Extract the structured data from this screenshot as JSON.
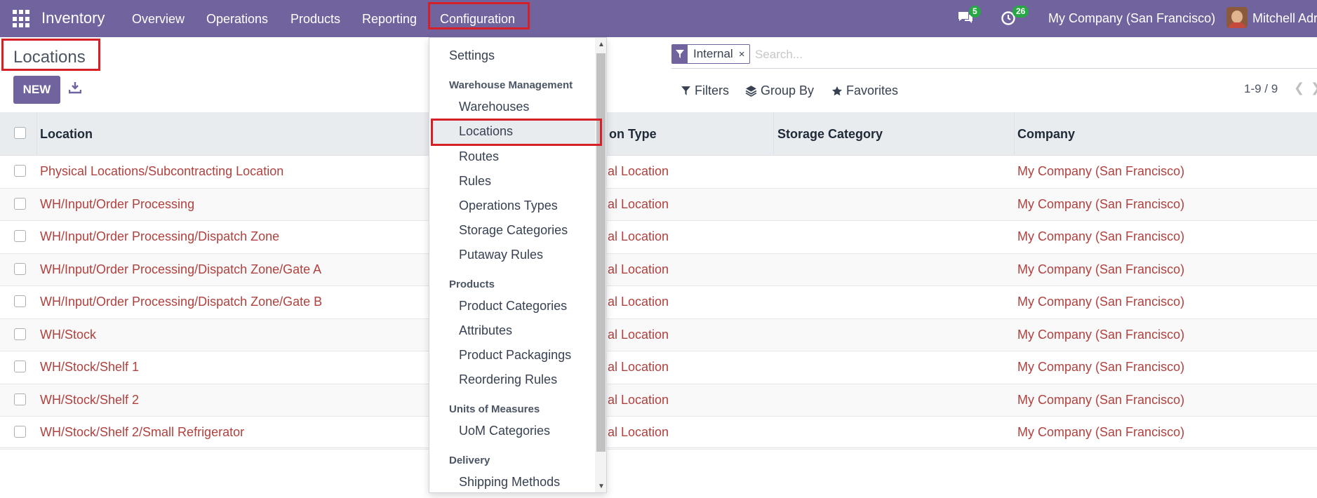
{
  "navbar": {
    "app_name": "Inventory",
    "menu": [
      "Overview",
      "Operations",
      "Products",
      "Reporting",
      "Configuration"
    ],
    "messages_count": "5",
    "activities_count": "26",
    "company": "My Company (San Francisco)",
    "user": "Mitchell Adr"
  },
  "control": {
    "title": "Locations",
    "new_label": "NEW",
    "facet_value": "Internal",
    "facet_remove": "×",
    "search_placeholder": "Search...",
    "filters_label": "Filters",
    "group_by_label": "Group By",
    "favorites_label": "Favorites",
    "pager": "1-9 / 9"
  },
  "table": {
    "headers": [
      "Location",
      "Location Type",
      "Storage Category",
      "Company"
    ],
    "header_type_visible": "on Type",
    "rows": [
      {
        "location": "Physical Locations/Subcontracting Location",
        "type": "al Location",
        "company": "My Company (San Francisco)"
      },
      {
        "location": "WH/Input/Order Processing",
        "type": "al Location",
        "company": "My Company (San Francisco)"
      },
      {
        "location": "WH/Input/Order Processing/Dispatch Zone",
        "type": "al Location",
        "company": "My Company (San Francisco)"
      },
      {
        "location": "WH/Input/Order Processing/Dispatch Zone/Gate A",
        "type": "al Location",
        "company": "My Company (San Francisco)"
      },
      {
        "location": "WH/Input/Order Processing/Dispatch Zone/Gate B",
        "type": "al Location",
        "company": "My Company (San Francisco)"
      },
      {
        "location": "WH/Stock",
        "type": "al Location",
        "company": "My Company (San Francisco)"
      },
      {
        "location": "WH/Stock/Shelf 1",
        "type": "al Location",
        "company": "My Company (San Francisco)"
      },
      {
        "location": "WH/Stock/Shelf 2",
        "type": "al Location",
        "company": "My Company (San Francisco)"
      },
      {
        "location": "WH/Stock/Shelf 2/Small Refrigerator",
        "type": "al Location",
        "company": "My Company (San Francisco)"
      }
    ]
  },
  "dropdown": {
    "settings": "Settings",
    "warehouse_header": "Warehouse Management",
    "warehouses": "Warehouses",
    "locations": "Locations",
    "routes": "Routes",
    "rules": "Rules",
    "operations_types": "Operations Types",
    "storage_categories": "Storage Categories",
    "putaway_rules": "Putaway Rules",
    "products_header": "Products",
    "product_categories": "Product Categories",
    "attributes": "Attributes",
    "product_packagings": "Product Packagings",
    "reordering_rules": "Reordering Rules",
    "uom_header": "Units of Measures",
    "uom_categories": "UoM Categories",
    "delivery_header": "Delivery",
    "shipping_methods": "Shipping Methods"
  },
  "colors": {
    "brand": "#71639e",
    "link": "#b0413e",
    "highlight": "#d62027",
    "badge": "#28a745"
  }
}
